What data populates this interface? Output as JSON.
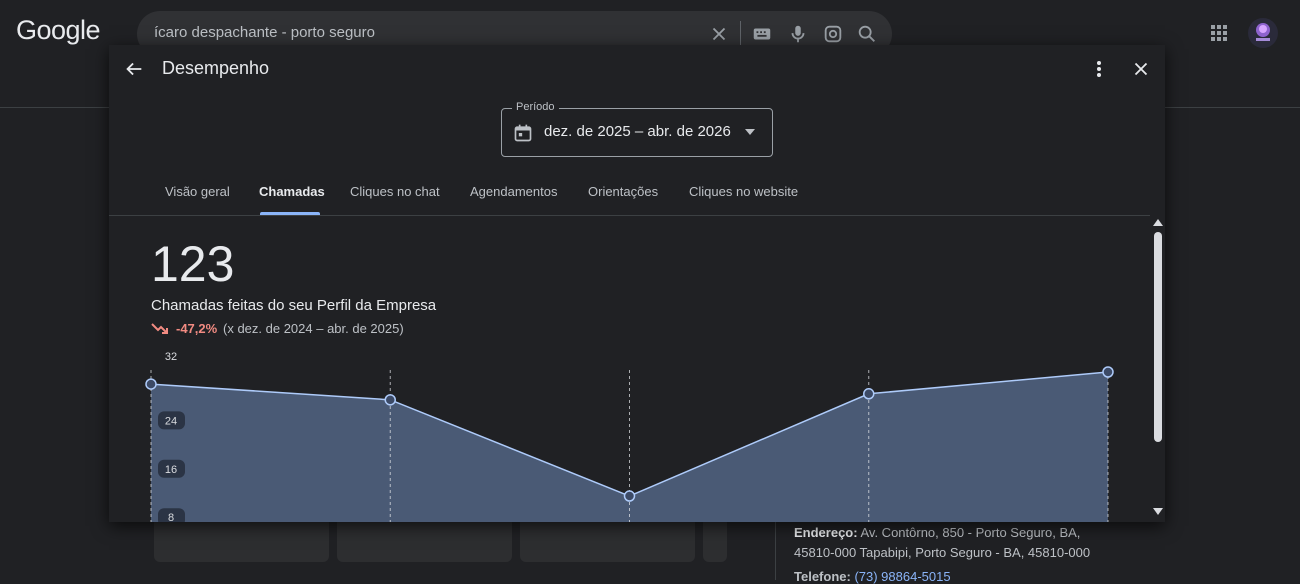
{
  "google": {
    "logo": "Google",
    "search": {
      "value": "ícaro despachante - porto seguro"
    }
  },
  "background": {
    "address_label": "Endereço:",
    "address_value": "Av. Contôrno, 850 - Porto Seguro, BA, 45810-000 Tapabipi, Porto Seguro - BA, 45810-000",
    "phone_label": "Telefone:",
    "phone_value": "(73) 98864-5015"
  },
  "dialog": {
    "title": "Desempenho",
    "period": {
      "label": "Período",
      "value": "dez. de 2025 – abr. de 2026"
    },
    "tabs": [
      {
        "label": "Visão geral"
      },
      {
        "label": "Chamadas",
        "active": true
      },
      {
        "label": "Cliques no chat"
      },
      {
        "label": "Agendamentos"
      },
      {
        "label": "Orientações"
      },
      {
        "label": "Cliques no website"
      }
    ],
    "metric": {
      "value": "123",
      "label": "Chamadas feitas do seu Perfil da Empresa",
      "change": "-47,2%",
      "comparison": "(x dez. de 2024 – abr. de 2025)"
    }
  },
  "chart_data": {
    "type": "area",
    "y_ticks": [
      "32",
      "24",
      "16",
      "8"
    ],
    "ylim": [
      0,
      32
    ],
    "x": [
      0,
      1,
      2,
      3,
      4
    ],
    "values": [
      30,
      27.4,
      11.5,
      28.4,
      32
    ],
    "colors": {
      "line": "#aecbfa",
      "fill": "#4a5a75",
      "point_fill": "#3c4a66"
    }
  }
}
